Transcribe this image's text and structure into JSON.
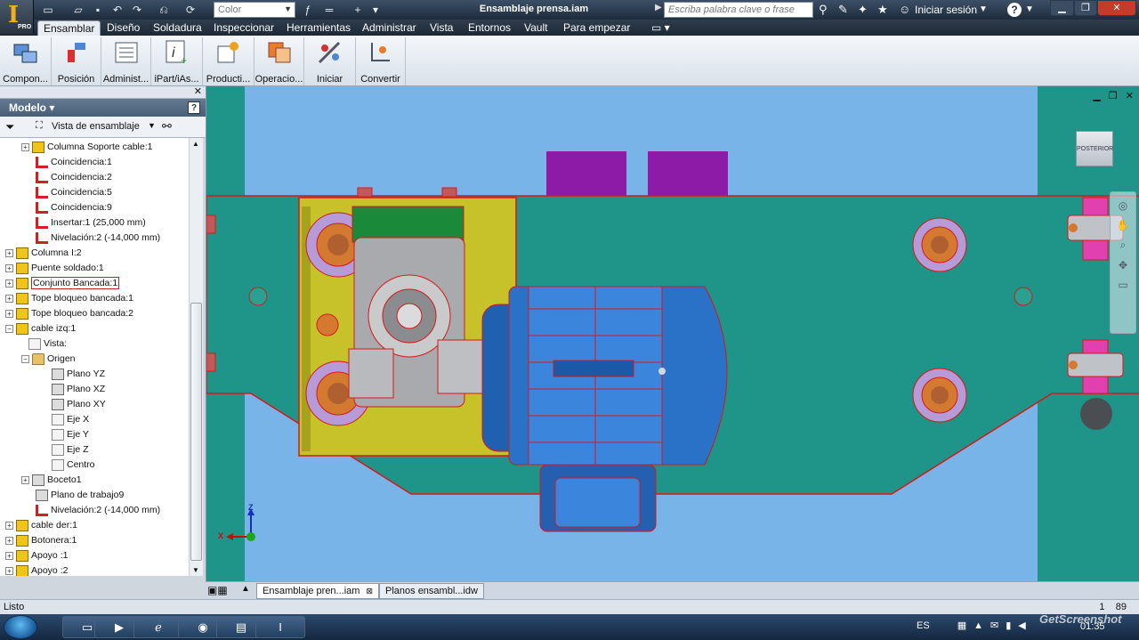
{
  "app": {
    "document_title": "Ensamblaje prensa.iam",
    "app_badge": "PRO",
    "color_select": "Color",
    "search_placeholder": "Escriba palabra clave o frase",
    "login_label": "Iniciar sesión",
    "help_label": "?"
  },
  "ribbon_tabs": [
    "Ensamblar",
    "Diseño",
    "Soldadura",
    "Inspeccionar",
    "Herramientas",
    "Administrar",
    "Vista",
    "Entornos",
    "Vault",
    "Para empezar"
  ],
  "ribbon_buttons": [
    "Compon...",
    "Posición",
    "Administ...",
    "iPart/iAs...",
    "Producti...",
    "Operacio...",
    "Iniciar",
    "Convertir"
  ],
  "browser": {
    "title": "Modelo",
    "view_label": "Vista de ensamblaje",
    "help_label": "?"
  },
  "tree": [
    {
      "label": "Columna Soporte cable:1",
      "icon": "assembly-icon",
      "exp": "+"
    },
    {
      "label": "Coincidencia:1",
      "icon": "constraint-icon"
    },
    {
      "label": "Coincidencia:2",
      "icon": "constraint-icon"
    },
    {
      "label": "Coincidencia:5",
      "icon": "constraint-icon"
    },
    {
      "label": "Coincidencia:9",
      "icon": "constraint-icon"
    },
    {
      "label": "Insertar:1 (25,000 mm)",
      "icon": "insert-icon"
    },
    {
      "label": "Nivelación:2 (-14,000 mm)",
      "icon": "flush-icon"
    },
    {
      "label": "Columna I:2",
      "icon": "assembly-icon",
      "exp": "+"
    },
    {
      "label": "Puente soldado:1",
      "icon": "weldment-icon",
      "exp": "+"
    },
    {
      "label": "Conjunto Bancada:1",
      "icon": "assembly-icon",
      "exp": "+",
      "selected": true
    },
    {
      "label": "Tope bloqueo bancada:1",
      "icon": "assembly-icon",
      "exp": "+"
    },
    {
      "label": "Tope bloqueo bancada:2",
      "icon": "assembly-icon",
      "exp": "+"
    },
    {
      "label": "cable izq:1",
      "icon": "assembly-icon",
      "exp": "−"
    },
    {
      "label": "Vista:",
      "icon": "view-icon"
    },
    {
      "label": "Origen",
      "icon": "folder-icon",
      "exp": "−"
    },
    {
      "label": "Plano YZ",
      "icon": "plane-icon"
    },
    {
      "label": "Plano XZ",
      "icon": "plane-icon"
    },
    {
      "label": "Plano XY",
      "icon": "plane-icon"
    },
    {
      "label": "Eje X",
      "icon": "axis-icon"
    },
    {
      "label": "Eje Y",
      "icon": "axis-icon"
    },
    {
      "label": "Eje Z",
      "icon": "axis-icon"
    },
    {
      "label": "Centro",
      "icon": "point-icon"
    },
    {
      "label": "Boceto1",
      "icon": "sketch-icon",
      "exp": "+"
    },
    {
      "label": "Plano de trabajo9",
      "icon": "plane-icon"
    },
    {
      "label": "Nivelación:2 (-14,000 mm)",
      "icon": "flush-icon"
    },
    {
      "label": "cable der:1",
      "icon": "assembly-icon",
      "exp": "+"
    },
    {
      "label": "Botonera:1",
      "icon": "assembly-icon",
      "exp": "+"
    },
    {
      "label": "Apoyo :1",
      "icon": "assembly-icon",
      "exp": "+"
    },
    {
      "label": "Apoyo :2",
      "icon": "assembly-icon",
      "exp": "+"
    }
  ],
  "viewport": {
    "viewcube_label": "POSTERIOR",
    "axis_x": "X",
    "axis_z": "Z"
  },
  "doc_tabs": [
    "Ensamblaje pren...iam",
    "Planos ensambl...idw"
  ],
  "status": {
    "text": "Listo",
    "right_a": "1",
    "right_b": "89"
  },
  "taskbar": {
    "lang": "ES",
    "clock": "01:35",
    "watermark": "GetScreenshot"
  },
  "colors": {
    "viewport_bg": "#79b4e8",
    "plate_teal": "#1f9488",
    "motor_blue": "#2a72c8",
    "gearbox_gray": "#a8aaad",
    "yellow_plate": "#c8c22a",
    "purple_block": "#8e1aa8",
    "highlight_red": "#d81818"
  }
}
